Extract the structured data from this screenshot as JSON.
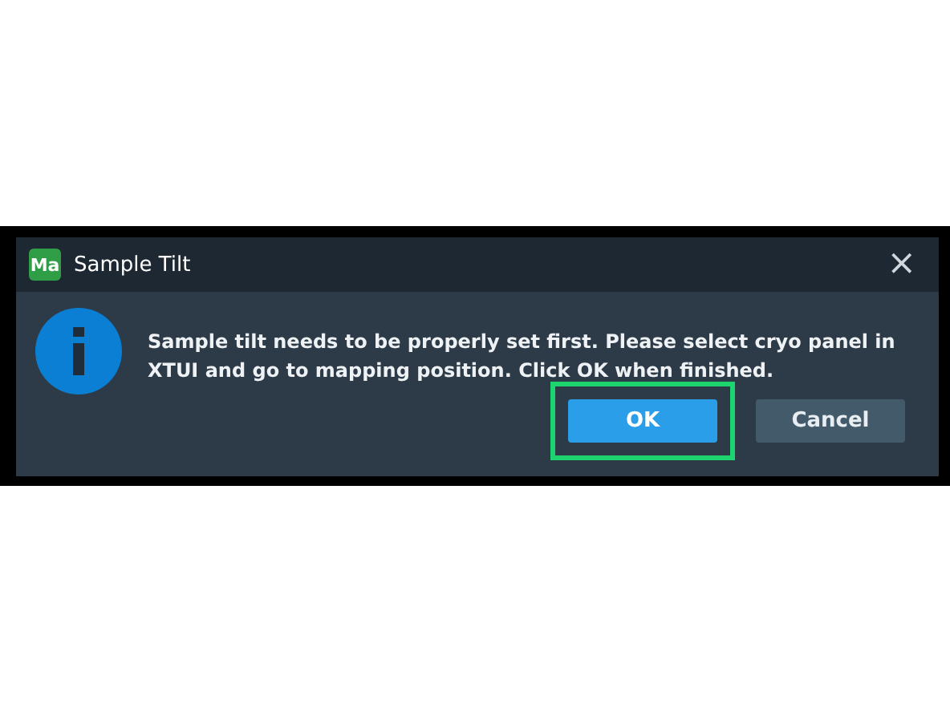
{
  "dialog": {
    "app_badge": "Ma",
    "title": "Sample Tilt",
    "close": "×",
    "message": "Sample tilt needs to be properly set first. Please select cryo panel in XTUI and go to mapping position. Click OK when finished.",
    "buttons": [
      {
        "label": "OK",
        "kind": "primary",
        "highlighted": true
      },
      {
        "label": "Cancel",
        "kind": "secondary",
        "highlighted": false
      }
    ]
  }
}
